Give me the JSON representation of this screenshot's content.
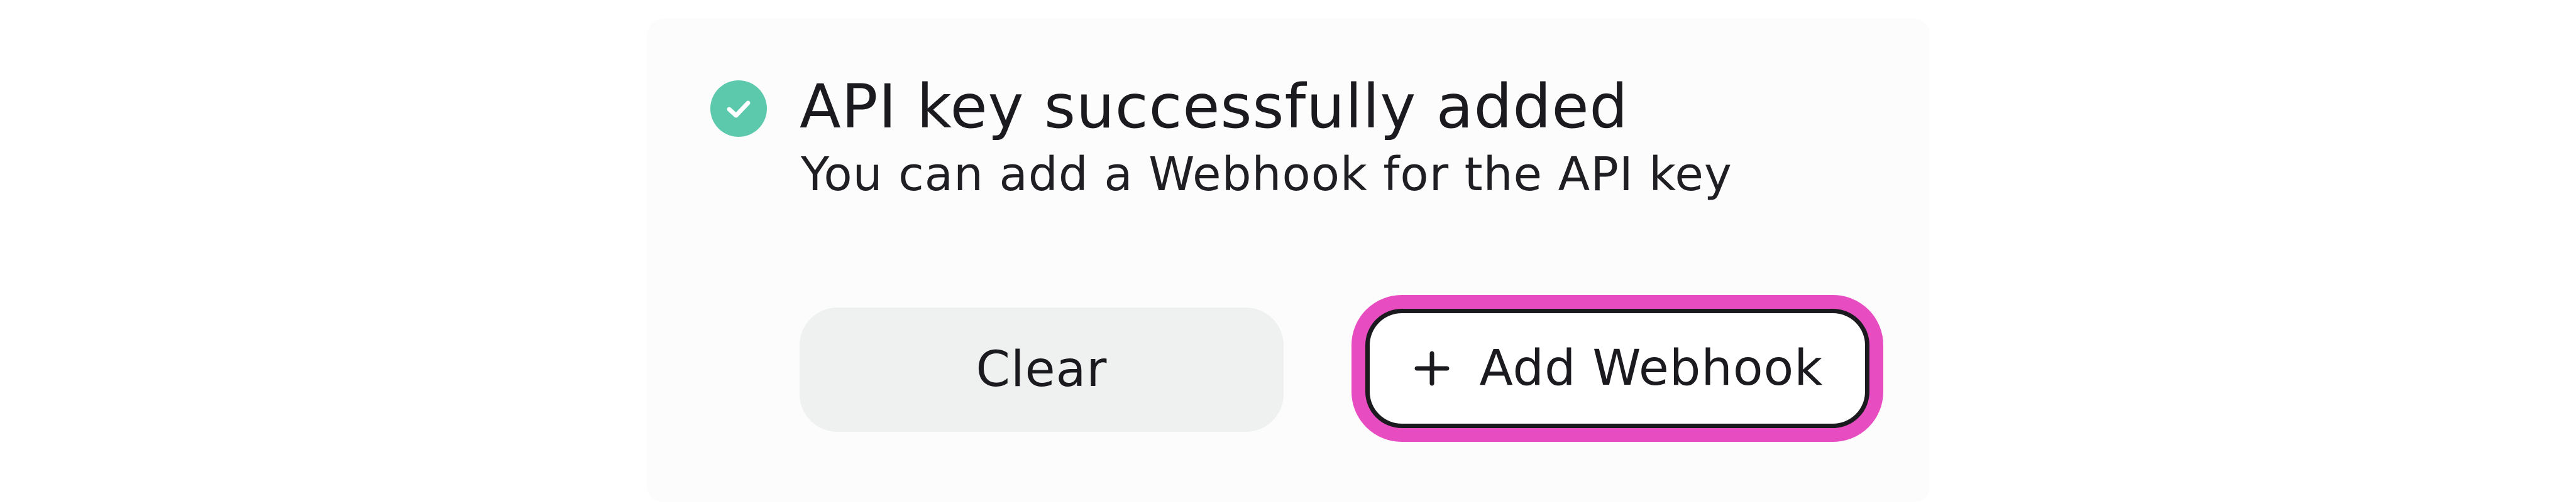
{
  "notification": {
    "title": "API key successfully added",
    "subtitle": "You can add a Webhook for the API key",
    "icon": "check-circle-icon",
    "icon_color": "#5cc9ad"
  },
  "actions": {
    "clear_label": "Clear",
    "add_webhook_label": "Add Webhook",
    "add_webhook_icon": "plus-icon",
    "highlight_color": "#e84cc1"
  }
}
